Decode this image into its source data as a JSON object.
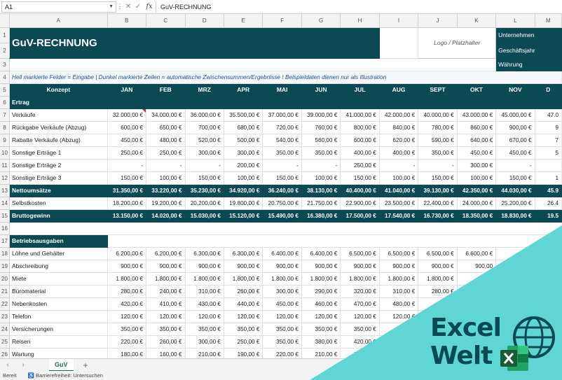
{
  "formula_bar": {
    "cell_ref": "A1",
    "formula": "GuV-RECHNUNG",
    "fx_label": "fx"
  },
  "columns": [
    "A",
    "B",
    "C",
    "D",
    "E",
    "F",
    "G",
    "H",
    "I",
    "J",
    "K",
    "L",
    "M"
  ],
  "header": {
    "title": "GuV-RECHNUNG",
    "logo_placeholder": "Logo / Platzhalter",
    "company_label": "Unternehmen",
    "fiscal_year_label": "Geschäftsjahr",
    "currency_label": "Währung"
  },
  "hint": "Hell markierte Felder = Eingabe | Dunkel markierte Zeilen = automatische Zwischensummen/Ergebnisse ! Beispieldaten dienen nur als Illustration",
  "table_header": {
    "concept": "Konzept",
    "months": [
      "JAN",
      "FEB",
      "MRZ",
      "APR",
      "MAI",
      "JUN",
      "JUL",
      "AUG",
      "SEPT",
      "OKT",
      "NOV",
      "D"
    ]
  },
  "sections": {
    "revenue": "Ertrag",
    "expenses": "Betriebsausgaben"
  },
  "rows": {
    "r7": {
      "label": "Verkäufe",
      "values": [
        "32.000,00 €",
        "34.000,00 €",
        "36.000,00 €",
        "35.500,00 €",
        "37.000,00 €",
        "39.000,00 €",
        "41.000,00 €",
        "42.000,00 €",
        "40.000,00 €",
        "43.000,00 €",
        "45.000,00 €",
        "47.0"
      ]
    },
    "r8": {
      "label": "Rückgabe Verkäufe (Abzug)",
      "values": [
        "600,00 €",
        "650,00 €",
        "700,00 €",
        "680,00 €",
        "720,00 €",
        "760,00 €",
        "800,00 €",
        "840,00 €",
        "780,00 €",
        "860,00 €",
        "900,00 €",
        "9"
      ]
    },
    "r9": {
      "label": "Rabatte Verkäufe (Abzug)",
      "values": [
        "450,00 €",
        "480,00 €",
        "520,00 €",
        "500,00 €",
        "540,00 €",
        "560,00 €",
        "600,00 €",
        "620,00 €",
        "590,00 €",
        "640,00 €",
        "670,00 €",
        "7"
      ]
    },
    "r10": {
      "label": "Sonstige Erträge 1",
      "values": [
        "250,00 €",
        "250,00 €",
        "300,00 €",
        "300,00 €",
        "350,00 €",
        "350,00 €",
        "400,00 €",
        "400,00 €",
        "350,00 €",
        "450,00 €",
        "450,00 €",
        "5"
      ]
    },
    "r11": {
      "label": "Sonstige Erträge 2",
      "values": [
        "-",
        "-",
        "-",
        "200,00 €",
        "-",
        "-",
        "250,00 €",
        "-",
        "-",
        "300,00 €",
        "-",
        ""
      ]
    },
    "r12": {
      "label": "Sonstige Erträge 3",
      "values": [
        "150,00 €",
        "100,00 €",
        "150,00 €",
        "100,00 €",
        "150,00 €",
        "100,00 €",
        "150,00 €",
        "100,00 €",
        "150,00 €",
        "100,00 €",
        "150,00 €",
        "1"
      ]
    },
    "r13": {
      "label": "Nettoumsätze",
      "values": [
        "31.350,00 €",
        "33.220,00 €",
        "35.230,00 €",
        "34.920,00 €",
        "36.240,00 €",
        "38.130,00 €",
        "40.400,00 €",
        "41.040,00 €",
        "39.130,00 €",
        "42.350,00 €",
        "44.030,00 €",
        "45.9"
      ]
    },
    "r14": {
      "label": "Selbstkosten",
      "values": [
        "18.200,00 €",
        "19.200,00 €",
        "20.200,00 €",
        "19.800,00 €",
        "20.750,00 €",
        "21.750,00 €",
        "22.900,00 €",
        "23.500,00 €",
        "22.400,00 €",
        "24.000,00 €",
        "25.200,00 €",
        "26.4"
      ]
    },
    "r15": {
      "label": "Bruttogewinn",
      "values": [
        "13.150,00 €",
        "14.020,00 €",
        "15.030,00 €",
        "15.120,00 €",
        "15.490,00 €",
        "16.380,00 €",
        "17.500,00 €",
        "17.540,00 €",
        "16.730,00 €",
        "18.350,00 €",
        "18.830,00 €",
        "19.5"
      ]
    },
    "r18": {
      "label": "Löhne und Gehälter",
      "values": [
        "6.200,00 €",
        "6.200,00 €",
        "6.300,00 €",
        "6.300,00 €",
        "6.400,00 €",
        "6.400,00 €",
        "6.500,00 €",
        "6.500,00 €",
        "6.500,00 €",
        "6.600,00 €",
        "",
        ""
      ]
    },
    "r19": {
      "label": "Abschreibung",
      "values": [
        "900,00 €",
        "900,00 €",
        "900,00 €",
        "900,00 €",
        "900,00 €",
        "900,00 €",
        "900,00 €",
        "900,00 €",
        "900,00 €",
        "900,00",
        "",
        ""
      ]
    },
    "r20": {
      "label": "Miete",
      "values": [
        "1.800,00 €",
        "1.800,00 €",
        "1.800,00 €",
        "1.800,00 €",
        "1.800,00 €",
        "1.800,00 €",
        "1.800,00 €",
        "1.800,00 €",
        "1.800,00 €",
        "",
        "",
        ""
      ]
    },
    "r21": {
      "label": "Büromaterial",
      "values": [
        "280,00 €",
        "240,00 €",
        "310,00 €",
        "260,00 €",
        "300,00 €",
        "290,00 €",
        "320,00 €",
        "310,00 €",
        "280,00 €",
        "",
        "",
        ""
      ]
    },
    "r22": {
      "label": "Nebenkosten",
      "values": [
        "420,00 €",
        "410,00 €",
        "430,00 €",
        "440,00 €",
        "450,00 €",
        "460,00 €",
        "470,00 €",
        "480,00 €",
        "",
        "",
        "",
        ""
      ]
    },
    "r23": {
      "label": "Telefon",
      "values": [
        "120,00 €",
        "120,00 €",
        "120,00 €",
        "120,00 €",
        "120,00 €",
        "120,00 €",
        "120,00 €",
        "120,00 €",
        "120,00",
        "",
        "",
        ""
      ]
    },
    "r24": {
      "label": "Versicherungen",
      "values": [
        "350,00 €",
        "350,00 €",
        "350,00 €",
        "350,00 €",
        "350,00 €",
        "350,00 €",
        "350,00 €",
        "",
        "",
        "",
        "",
        ""
      ]
    },
    "r25": {
      "label": "Reisen",
      "values": [
        "220,00 €",
        "260,00 €",
        "300,00 €",
        "250,00 €",
        "350,00 €",
        "380,00 €",
        "420,00 €",
        "",
        "",
        "",
        "",
        ""
      ]
    },
    "r26": {
      "label": "Wartung",
      "values": [
        "180,00 €",
        "160,00 €",
        "210,00 €",
        "190,00 €",
        "220,00 €",
        "210,00 €",
        "240,00 €",
        "",
        "",
        "",
        "",
        ""
      ]
    }
  },
  "sheet_tabs": {
    "active": "GuV",
    "add_symbol": "+",
    "prev": "‹",
    "next": "›"
  },
  "status_bar": {
    "ready": "Bereit",
    "accessibility": "Barrierefreiheit: Untersuchen"
  },
  "brand": {
    "line1": "Excel",
    "line2": "Welt"
  },
  "colors": {
    "dark_teal": "#0b4a52",
    "overlay_cyan": "#5fd6d3",
    "excel_green": "#1e7145"
  }
}
